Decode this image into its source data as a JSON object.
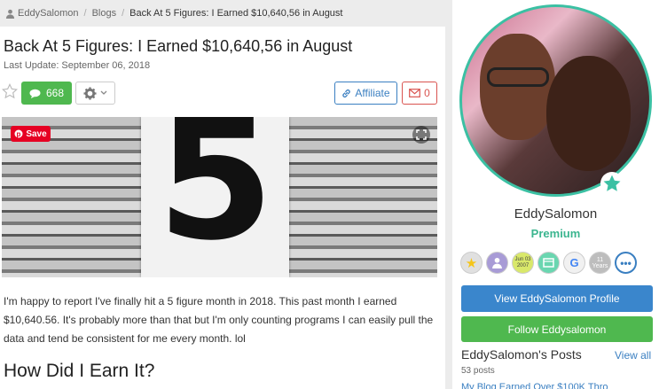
{
  "breadcrumb": {
    "user": "EddySalomon",
    "section": "Blogs",
    "current": "Back At 5 Figures: I Earned $10,640,56 in August"
  },
  "article": {
    "title": "Back At 5 Figures: I Earned $10,640,56 in August",
    "last_update": "Last Update: September 06, 2018",
    "comment_count": "668",
    "affiliate_label": "Affiliate",
    "flag_count": "0",
    "pin_save_label": "Save",
    "image_numeral": "5",
    "paragraph": "I'm happy to report I've finally hit a 5 figure month in 2018. This past month I earned $10,640.56. It's probably more than that but I'm only counting programs I can easily pull the data and tend be consistent for me every month. lol",
    "heading": "How Did I Earn It?"
  },
  "sidebar": {
    "username": "EddySalomon",
    "rank": "Premium",
    "badges": {
      "date_line1": "Jun 03",
      "date_line2": "2007",
      "google": "G",
      "years_num": "11",
      "years_label": "Years",
      "more": "•••"
    },
    "profile_button": "View EddySalomon Profile",
    "follow_button": "Follow Eddysalomon",
    "posts_title": "EddySalomon's Posts",
    "view_all": "View all",
    "posts_count": "53 posts",
    "post_peek": "My Blog Earned Over $100K Thro"
  },
  "colors": {
    "green": "#4fb84f",
    "blue": "#3a86cc",
    "red": "#d9534f",
    "teal": "#3bc0a3"
  }
}
